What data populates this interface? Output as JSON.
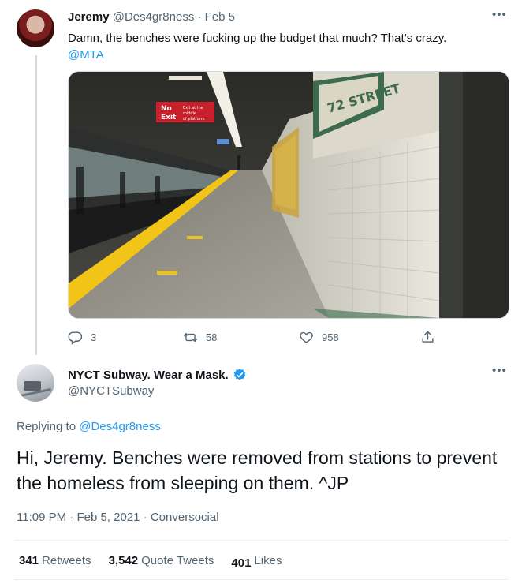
{
  "tweet1": {
    "name": "Jeremy",
    "handle": "@Des4gr8ness",
    "separator": "·",
    "time": "Feb 5",
    "more": "•••",
    "text": "Damn, the benches were fucking up the budget that much? That’s crazy.",
    "mention": "@MTA",
    "photo": {
      "wall_sign": "72 STREET",
      "exit_sign_no": "No",
      "exit_sign_exit": "Exit",
      "exit_sign_detail_1": "Exit at the",
      "exit_sign_detail_2": "middle",
      "exit_sign_detail_3": "of platform"
    },
    "actions": {
      "reply_count": "3",
      "retweet_count": "58",
      "like_count": "958"
    }
  },
  "tweet2": {
    "name": "NYCT Subway. Wear a Mask.",
    "handle": "@NYCTSubway",
    "more": "•••",
    "replying_prefix": "Replying to",
    "replying_to": "@Des4gr8ness",
    "text": "Hi, Jeremy. Benches were removed from stations to prevent the homeless from sleeping on them. ^JP",
    "time": "11:09 PM",
    "date": "Feb 5, 2021",
    "source": "Conversocial",
    "separator": "·"
  },
  "stats": {
    "retweets_count": "341",
    "retweets_label": "Retweets",
    "quotes_count": "3,542",
    "quotes_label": "Quote Tweets",
    "likes_count": "401",
    "likes_label": "Likes"
  },
  "colors": {
    "link": "#1d9bf0",
    "secondary_text": "#536471",
    "platform_stripe": "#f2c418"
  }
}
